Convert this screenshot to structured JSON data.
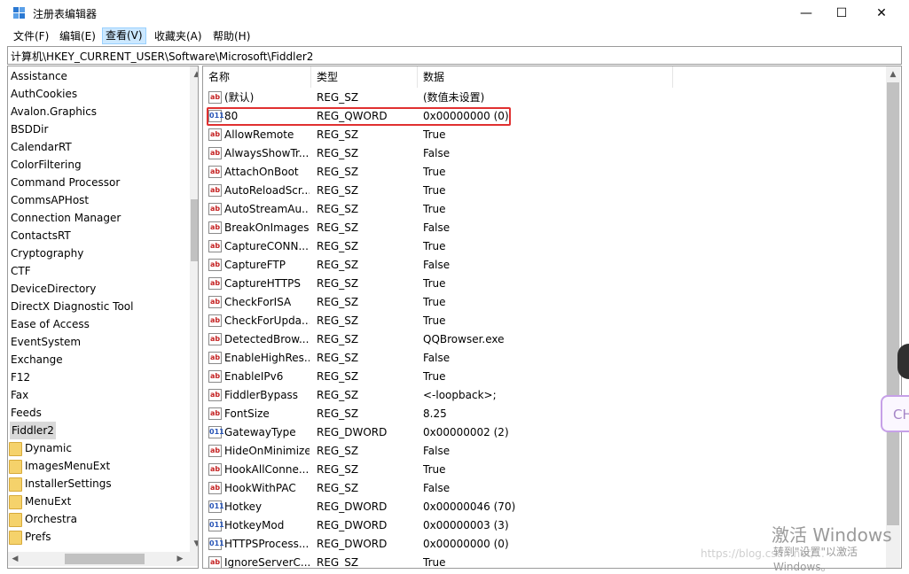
{
  "window": {
    "title": "注册表编辑器",
    "minimize": "—",
    "maximize": "☐",
    "close": "✕"
  },
  "menu": [
    "文件(F)",
    "编辑(E)",
    "查看(V)",
    "收藏夹(A)",
    "帮助(H)"
  ],
  "address": "计算机\\HKEY_CURRENT_USER\\Software\\Microsoft\\Fiddler2",
  "tree": {
    "items": [
      "Assistance",
      "AuthCookies",
      "Avalon.Graphics",
      "BSDDir",
      "CalendarRT",
      "ColorFiltering",
      "Command Processor",
      "CommsAPHost",
      "Connection Manager",
      "ContactsRT",
      "Cryptography",
      "CTF",
      "DeviceDirectory",
      "DirectX Diagnostic Tool",
      "Ease of Access",
      "EventSystem",
      "Exchange",
      "F12",
      "Fax",
      "Feeds"
    ],
    "selected": "Fiddler2",
    "children": [
      "Dynamic",
      "ImagesMenuExt",
      "InstallerSettings",
      "MenuExt",
      "Orchestra",
      "Prefs"
    ]
  },
  "list": {
    "headers": [
      "名称",
      "类型",
      "数据"
    ],
    "rows": [
      {
        "icon": "sz",
        "name": "(默认)",
        "type": "REG_SZ",
        "data": "(数值未设置)"
      },
      {
        "icon": "bin",
        "name": "80",
        "type": "REG_QWORD",
        "data": "0x00000000 (0)"
      },
      {
        "icon": "sz",
        "name": "AllowRemote",
        "type": "REG_SZ",
        "data": "True"
      },
      {
        "icon": "sz",
        "name": "AlwaysShowTr...",
        "type": "REG_SZ",
        "data": "False"
      },
      {
        "icon": "sz",
        "name": "AttachOnBoot",
        "type": "REG_SZ",
        "data": "True"
      },
      {
        "icon": "sz",
        "name": "AutoReloadScr...",
        "type": "REG_SZ",
        "data": "True"
      },
      {
        "icon": "sz",
        "name": "AutoStreamAu...",
        "type": "REG_SZ",
        "data": "True"
      },
      {
        "icon": "sz",
        "name": "BreakOnImages",
        "type": "REG_SZ",
        "data": "False"
      },
      {
        "icon": "sz",
        "name": "CaptureCONN...",
        "type": "REG_SZ",
        "data": "True"
      },
      {
        "icon": "sz",
        "name": "CaptureFTP",
        "type": "REG_SZ",
        "data": "False"
      },
      {
        "icon": "sz",
        "name": "CaptureHTTPS",
        "type": "REG_SZ",
        "data": "True"
      },
      {
        "icon": "sz",
        "name": "CheckForISA",
        "type": "REG_SZ",
        "data": "True"
      },
      {
        "icon": "sz",
        "name": "CheckForUpda...",
        "type": "REG_SZ",
        "data": "True"
      },
      {
        "icon": "sz",
        "name": "DetectedBrow...",
        "type": "REG_SZ",
        "data": "QQBrowser.exe"
      },
      {
        "icon": "sz",
        "name": "EnableHighRes...",
        "type": "REG_SZ",
        "data": "False"
      },
      {
        "icon": "sz",
        "name": "EnableIPv6",
        "type": "REG_SZ",
        "data": "True"
      },
      {
        "icon": "sz",
        "name": "FiddlerBypass",
        "type": "REG_SZ",
        "data": "<-loopback>;"
      },
      {
        "icon": "sz",
        "name": "FontSize",
        "type": "REG_SZ",
        "data": "8.25"
      },
      {
        "icon": "bin",
        "name": "GatewayType",
        "type": "REG_DWORD",
        "data": "0x00000002 (2)"
      },
      {
        "icon": "sz",
        "name": "HideOnMinimize",
        "type": "REG_SZ",
        "data": "False"
      },
      {
        "icon": "sz",
        "name": "HookAllConne...",
        "type": "REG_SZ",
        "data": "True"
      },
      {
        "icon": "sz",
        "name": "HookWithPAC",
        "type": "REG_SZ",
        "data": "False"
      },
      {
        "icon": "bin",
        "name": "Hotkey",
        "type": "REG_DWORD",
        "data": "0x00000046 (70)"
      },
      {
        "icon": "bin",
        "name": "HotkeyMod",
        "type": "REG_DWORD",
        "data": "0x00000003 (3)"
      },
      {
        "icon": "bin",
        "name": "HTTPSProcess...",
        "type": "REG_DWORD",
        "data": "0x00000000 (0)"
      },
      {
        "icon": "sz",
        "name": "IgnoreServerC...",
        "type": "REG_SZ",
        "data": "True"
      }
    ]
  },
  "icons": {
    "sz": "ab",
    "bin": "011"
  },
  "overlay": {
    "watermark_line1": "激活 Windows",
    "watermark_line2": "转到\"设置\"以激活 Windows。",
    "blog": "https://blog.csdn.net/...",
    "badge": "CH"
  }
}
